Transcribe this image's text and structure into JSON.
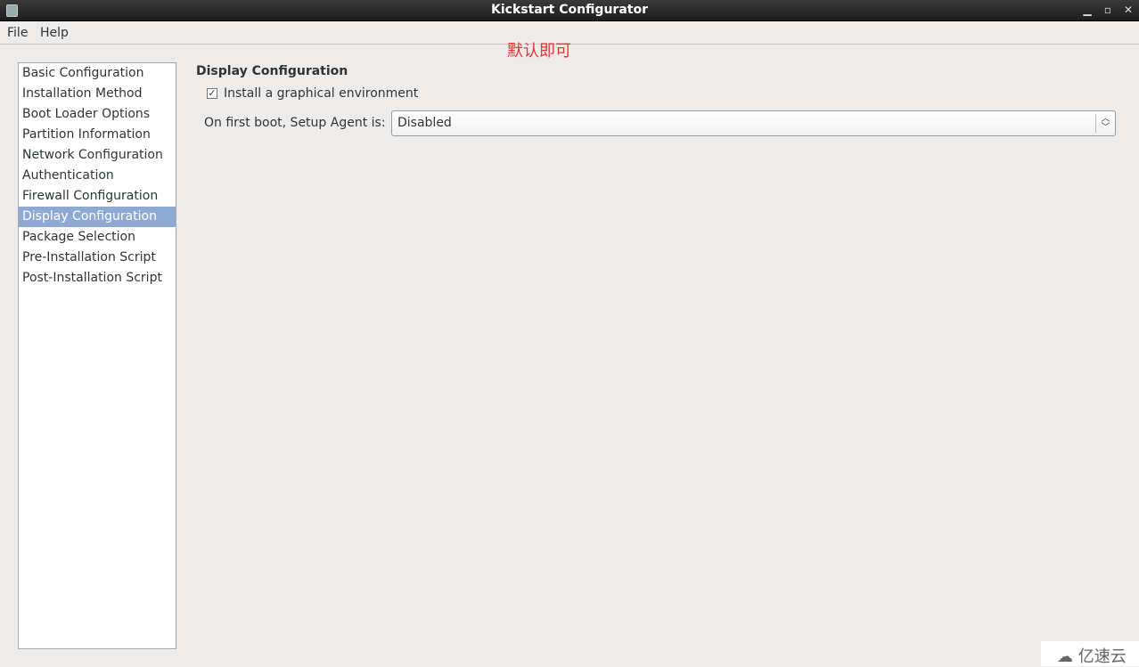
{
  "window": {
    "title": "Kickstart Configurator",
    "controls": {
      "minimize": "minimize-icon",
      "maximize": "maximize-icon",
      "close": "close-icon"
    }
  },
  "menu": [
    "File",
    "Help"
  ],
  "annotation": "默认即可",
  "annotation_color": "#e8322f",
  "sidebar": {
    "items": [
      "Basic Configuration",
      "Installation Method",
      "Boot Loader Options",
      "Partition Information",
      "Network Configuration",
      "Authentication",
      "Firewall Configuration",
      "Display Configuration",
      "Package Selection",
      "Pre-Installation Script",
      "Post-Installation Script"
    ],
    "selected": "Display Configuration",
    "selected_color": "#8eaad4"
  },
  "main": {
    "heading": "Display Configuration",
    "checkbox": {
      "label": "Install a graphical environment",
      "checked": true
    },
    "setup_agent": {
      "label": "On first boot, Setup Agent is:",
      "value": "Disabled"
    }
  },
  "watermark": "亿速云"
}
